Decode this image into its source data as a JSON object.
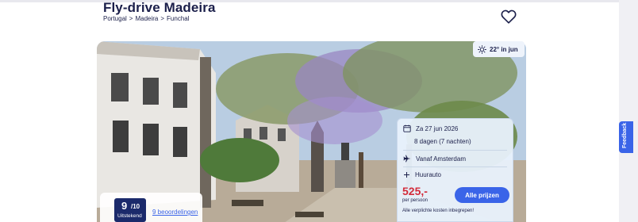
{
  "header": {
    "title": "Fly-drive Madeira",
    "breadcrumb": [
      "Portugal",
      "Madeira",
      "Funchal"
    ],
    "breadcrumb_separator": ">"
  },
  "weather": {
    "text": "22° in jun",
    "icon": "sun-icon"
  },
  "booking_card": {
    "date": "Za 27 jun 2026",
    "duration": "8 dagen (7 nachten)",
    "departure": "Vanaf Amsterdam",
    "extra": "Huurauto",
    "price": "525,-",
    "price_unit": "per persoon",
    "cta_label": "Alle prijzen",
    "costs_note": "Alle verplichte kosten inbegrepen!"
  },
  "rating": {
    "score": "9",
    "max": "/10",
    "label": "Uitstekend",
    "reviews_link": "9 beoordelingen"
  },
  "feedback": {
    "label": "Feedback"
  },
  "colors": {
    "primary_text": "#1b1f4a",
    "accent_blue": "#3a64e8",
    "price_red": "#d22b3a",
    "badge_navy": "#1b2a6b"
  }
}
